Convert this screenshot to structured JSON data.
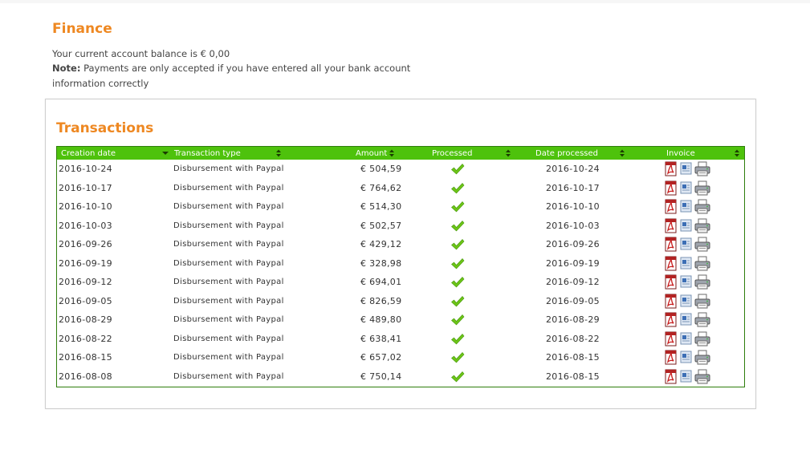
{
  "finance": {
    "title": "Finance",
    "balance_text": "Your current account balance is € 0,00",
    "note_label": "Note:",
    "note_text": " Payments are only accepted if you have entered all your bank account information correctly"
  },
  "transactions": {
    "title": "Transactions",
    "columns": [
      "Creation date",
      "Transaction type",
      "Amount",
      "Processed",
      "Date processed",
      "Invoice"
    ],
    "rows": [
      {
        "creation_date": "2016-10-24",
        "type": "Disbursement with Paypal",
        "amount": "€ 504,59",
        "date_processed": "2016-10-24"
      },
      {
        "creation_date": "2016-10-17",
        "type": "Disbursement with Paypal",
        "amount": "€ 764,62",
        "date_processed": "2016-10-17"
      },
      {
        "creation_date": "2016-10-10",
        "type": "Disbursement with Paypal",
        "amount": "€ 514,30",
        "date_processed": "2016-10-10"
      },
      {
        "creation_date": "2016-10-03",
        "type": "Disbursement with Paypal",
        "amount": "€ 502,57",
        "date_processed": "2016-10-03"
      },
      {
        "creation_date": "2016-09-26",
        "type": "Disbursement with Paypal",
        "amount": "€ 429,12",
        "date_processed": "2016-09-26"
      },
      {
        "creation_date": "2016-09-19",
        "type": "Disbursement with Paypal",
        "amount": "€ 328,98",
        "date_processed": "2016-09-19"
      },
      {
        "creation_date": "2016-09-12",
        "type": "Disbursement with Paypal",
        "amount": "€ 694,01",
        "date_processed": "2016-09-12"
      },
      {
        "creation_date": "2016-09-05",
        "type": "Disbursement with Paypal",
        "amount": "€ 826,59",
        "date_processed": "2016-09-05"
      },
      {
        "creation_date": "2016-08-29",
        "type": "Disbursement with Paypal",
        "amount": "€ 489,80",
        "date_processed": "2016-08-29"
      },
      {
        "creation_date": "2016-08-22",
        "type": "Disbursement with Paypal",
        "amount": "€ 638,41",
        "date_processed": "2016-08-22"
      },
      {
        "creation_date": "2016-08-15",
        "type": "Disbursement with Paypal",
        "amount": "€ 657,02",
        "date_processed": "2016-08-15"
      },
      {
        "creation_date": "2016-08-08",
        "type": "Disbursement with Paypal",
        "amount": "€ 750,14",
        "date_processed": "2016-08-15"
      }
    ]
  },
  "icons": {
    "processed": "checkmark-icon",
    "invoice": [
      "pdf-icon",
      "document-icon",
      "printer-icon"
    ],
    "sort_desc": "sort-down-icon",
    "sort_both": "sort-updown-icon"
  },
  "colors": {
    "heading": "#ee8822",
    "header_bg": "#4ec20c",
    "grid_border": "#2e7d0c",
    "check": "#6cc417"
  }
}
